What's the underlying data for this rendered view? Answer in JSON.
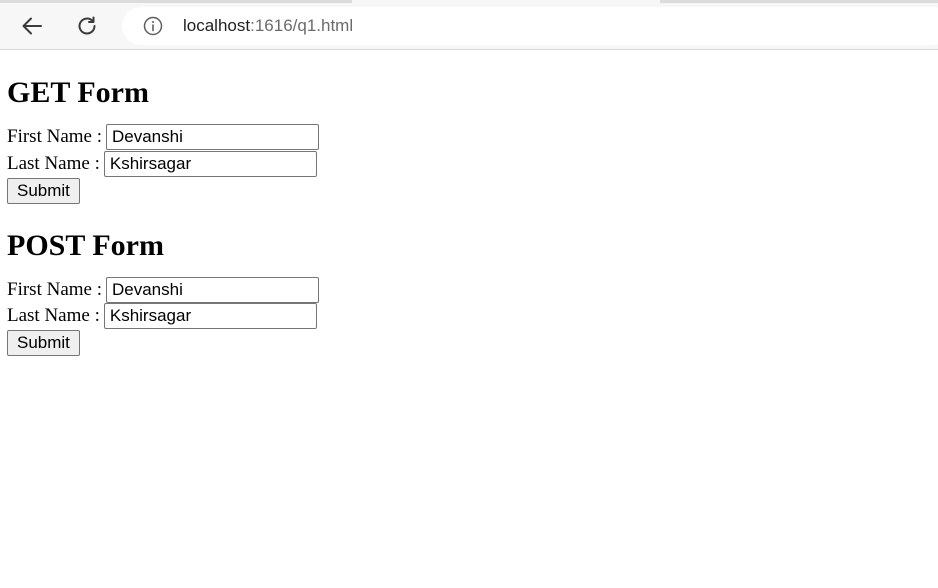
{
  "browser": {
    "url_host": "localhost",
    "url_rest": ":1616/q1.html"
  },
  "get_form": {
    "title": "GET Form",
    "first_label": "First Name :",
    "first_value": "Devanshi",
    "last_label": "Last Name :",
    "last_value": "Kshirsagar",
    "submit_label": "Submit"
  },
  "post_form": {
    "title": "POST Form",
    "first_label": "First Name :",
    "first_value": "Devanshi",
    "last_label": "Last Name :",
    "last_value": "Kshirsagar",
    "submit_label": "Submit"
  }
}
